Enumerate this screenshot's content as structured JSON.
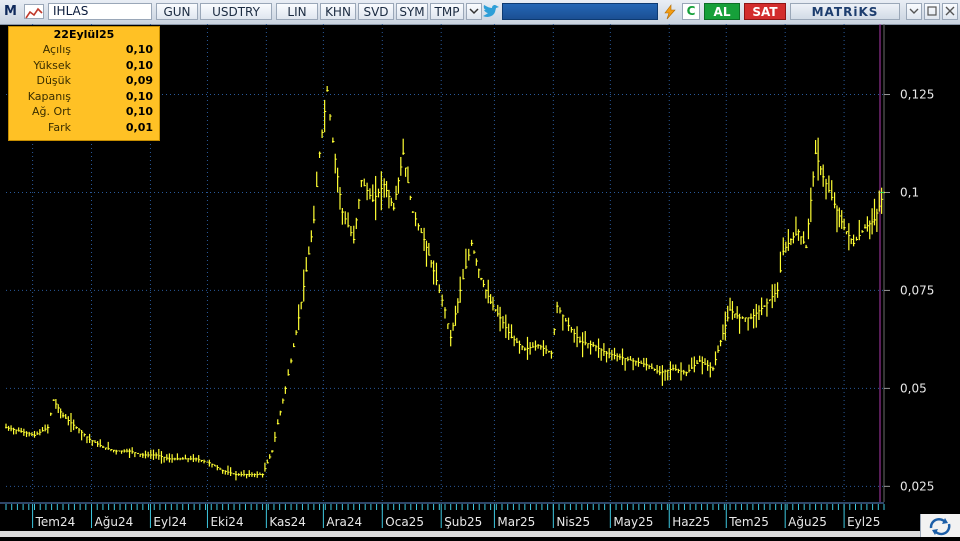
{
  "toolbar": {
    "logo": "M",
    "symbol": "IHLAS",
    "buttons": [
      "GUN",
      "USDTRY",
      "LIN",
      "KHN",
      "SVD",
      "SYM",
      "TMP"
    ],
    "buy_label": "AL",
    "sell_label": "SAT",
    "brand": "MATRiKS",
    "colors": {
      "buy": "#16a03a",
      "sell": "#d32d2d"
    }
  },
  "info_box": {
    "date": "22Eylül25",
    "rows": [
      {
        "label": "Açılış",
        "value": "0,10"
      },
      {
        "label": "Yüksek",
        "value": "0,10"
      },
      {
        "label": "Düşük",
        "value": "0,09"
      },
      {
        "label": "Kapanış",
        "value": "0,10"
      },
      {
        "label": "Ağ. Ort",
        "value": "0,10"
      },
      {
        "label": "Fark",
        "value": "0,01"
      }
    ]
  },
  "chart_data": {
    "type": "line",
    "style": "ohlc-bars",
    "series_color": "#ffff33",
    "y_ticks": [
      "0,125",
      "0,1",
      "0,075",
      "0,05",
      "0,025"
    ],
    "y_tick_values": [
      0.125,
      0.1,
      0.075,
      0.05,
      0.025
    ],
    "ylim": [
      0.021,
      0.143
    ],
    "x_labels": [
      "Tem24",
      "Ağu24",
      "Eyl24",
      "Eki24",
      "Kas24",
      "Ara24",
      "Oca25",
      "Şub25",
      "Mar25",
      "Nis25",
      "May25",
      "Haz25",
      "Tem25",
      "Ağu25",
      "Eyl25"
    ],
    "x_start": "2024-06-17",
    "x_end": "2025-09-22",
    "grid": true,
    "points": [
      [
        "2024-06-17",
        0.04
      ],
      [
        "2024-06-25",
        0.039
      ],
      [
        "2024-07-02",
        0.038
      ],
      [
        "2024-07-09",
        0.04
      ],
      [
        "2024-07-12",
        0.047
      ],
      [
        "2024-07-17",
        0.043
      ],
      [
        "2024-07-24",
        0.04
      ],
      [
        "2024-07-31",
        0.037
      ],
      [
        "2024-08-07",
        0.035
      ],
      [
        "2024-08-14",
        0.034
      ],
      [
        "2024-08-21",
        0.034
      ],
      [
        "2024-08-28",
        0.033
      ],
      [
        "2024-09-04",
        0.033
      ],
      [
        "2024-09-11",
        0.032
      ],
      [
        "2024-09-18",
        0.032
      ],
      [
        "2024-09-25",
        0.032
      ],
      [
        "2024-10-02",
        0.031
      ],
      [
        "2024-10-09",
        0.029
      ],
      [
        "2024-10-16",
        0.028
      ],
      [
        "2024-10-23",
        0.028
      ],
      [
        "2024-10-30",
        0.028
      ],
      [
        "2024-11-04",
        0.034
      ],
      [
        "2024-11-07",
        0.041
      ],
      [
        "2024-11-11",
        0.05
      ],
      [
        "2024-11-14",
        0.057
      ],
      [
        "2024-11-18",
        0.068
      ],
      [
        "2024-11-22",
        0.08
      ],
      [
        "2024-11-26",
        0.093
      ],
      [
        "2024-11-29",
        0.11
      ],
      [
        "2024-12-03",
        0.126
      ],
      [
        "2024-12-06",
        0.113
      ],
      [
        "2024-12-11",
        0.095
      ],
      [
        "2024-12-17",
        0.088
      ],
      [
        "2024-12-21",
        0.103
      ],
      [
        "2024-12-27",
        0.098
      ],
      [
        "2025-01-02",
        0.102
      ],
      [
        "2025-01-07",
        0.096
      ],
      [
        "2025-01-12",
        0.11
      ],
      [
        "2025-01-17",
        0.095
      ],
      [
        "2025-01-23",
        0.088
      ],
      [
        "2025-01-28",
        0.08
      ],
      [
        "2025-02-03",
        0.07
      ],
      [
        "2025-02-06",
        0.063
      ],
      [
        "2025-02-11",
        0.075
      ],
      [
        "2025-02-17",
        0.087
      ],
      [
        "2025-02-22",
        0.078
      ],
      [
        "2025-02-27",
        0.072
      ],
      [
        "2025-03-04",
        0.068
      ],
      [
        "2025-03-10",
        0.063
      ],
      [
        "2025-03-17",
        0.06
      ],
      [
        "2025-03-24",
        0.061
      ],
      [
        "2025-03-31",
        0.059
      ],
      [
        "2025-04-03",
        0.071
      ],
      [
        "2025-04-09",
        0.066
      ],
      [
        "2025-04-15",
        0.062
      ],
      [
        "2025-04-22",
        0.061
      ],
      [
        "2025-04-29",
        0.059
      ],
      [
        "2025-05-06",
        0.058
      ],
      [
        "2025-05-13",
        0.057
      ],
      [
        "2025-05-20",
        0.056
      ],
      [
        "2025-05-27",
        0.054
      ],
      [
        "2025-06-03",
        0.055
      ],
      [
        "2025-06-10",
        0.054
      ],
      [
        "2025-06-17",
        0.057
      ],
      [
        "2025-06-24",
        0.055
      ],
      [
        "2025-06-28",
        0.062
      ],
      [
        "2025-07-03",
        0.07
      ],
      [
        "2025-07-08",
        0.068
      ],
      [
        "2025-07-14",
        0.068
      ],
      [
        "2025-07-21",
        0.071
      ],
      [
        "2025-07-28",
        0.075
      ],
      [
        "2025-07-31",
        0.085
      ],
      [
        "2025-08-04",
        0.088
      ],
      [
        "2025-08-08",
        0.09
      ],
      [
        "2025-08-12",
        0.086
      ],
      [
        "2025-08-17",
        0.11
      ],
      [
        "2025-08-21",
        0.104
      ],
      [
        "2025-08-27",
        0.097
      ],
      [
        "2025-09-01",
        0.091
      ],
      [
        "2025-09-06",
        0.087
      ],
      [
        "2025-09-12",
        0.091
      ],
      [
        "2025-09-17",
        0.093
      ],
      [
        "2025-09-22",
        0.1
      ]
    ]
  }
}
